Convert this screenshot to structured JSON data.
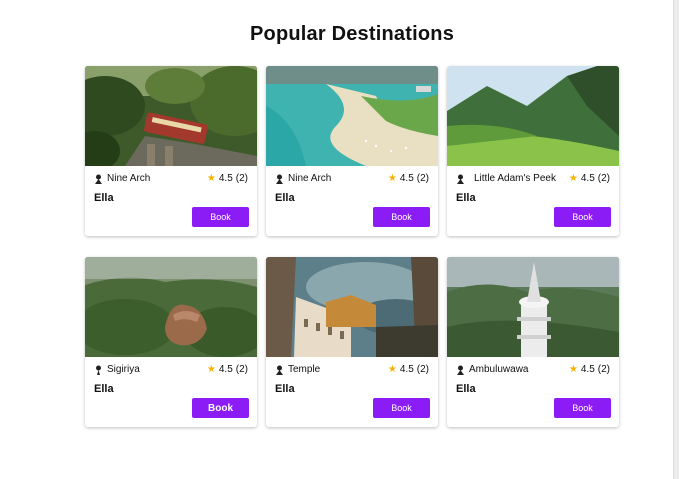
{
  "page": {
    "title": "Popular Destinations"
  },
  "colors": {
    "book_button": "#8c1cf6",
    "star": "#f5b301"
  },
  "cards": [
    {
      "image": "railway bridge with train in jungle",
      "place": "Nine Arch",
      "rating": "4.5",
      "reviews": "(2)",
      "city": "Ella",
      "book_label": "Book",
      "pin_icon": "location-pin-icon",
      "star_icon": "star-icon"
    },
    {
      "image": "aerial turquoise lagoon with boats",
      "place": "Nine Arch",
      "rating": "4.5",
      "reviews": "(2)",
      "city": "Ella",
      "book_label": "Book",
      "pin_icon": "location-pin-icon",
      "star_icon": "star-icon"
    },
    {
      "image": "green mountain peak landscape",
      "place": "Little Adam's Peek",
      "rating": "4.5",
      "reviews": "(2)",
      "city": "Ella",
      "book_label": "Book",
      "pin_icon": "location-pin-icon",
      "star_icon": "star-icon"
    },
    {
      "image": "aerial view of rock fortress in forest",
      "place": "Sigiriya",
      "rating": "4.5",
      "reviews": "(2)",
      "city": "Ella",
      "book_label": "Book",
      "pin_icon": "location-pin-icon",
      "star_icon": "star-icon"
    },
    {
      "image": "temple building against cloudy sky",
      "place": "Temple",
      "rating": "4.5",
      "reviews": "(2)",
      "city": "Ella",
      "book_label": "Book",
      "pin_icon": "location-pin-icon",
      "star_icon": "star-icon"
    },
    {
      "image": "white stupa tower in green hills",
      "place": "Ambuluwawa",
      "rating": "4.5",
      "reviews": "(2)",
      "city": "Ella",
      "book_label": "Book",
      "pin_icon": "location-pin-icon",
      "star_icon": "star-icon"
    }
  ]
}
